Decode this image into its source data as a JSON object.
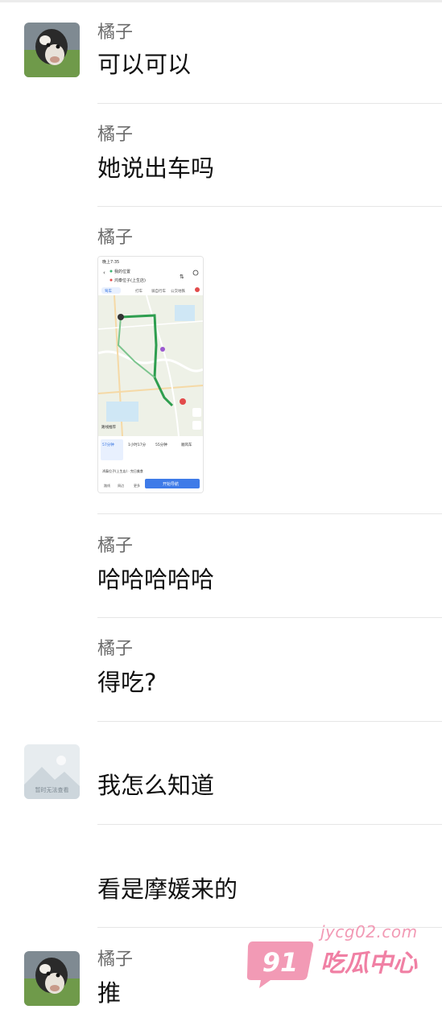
{
  "messages": [
    {
      "sender": "橘子",
      "text": "可以可以",
      "avatar": "cow-avatar"
    },
    {
      "sender": "橘子",
      "text": "她说出车吗"
    },
    {
      "sender": "橘子",
      "type": "image",
      "image": "map-navigation-screenshot"
    },
    {
      "sender": "橘子",
      "text": "哈哈哈哈哈"
    },
    {
      "sender": "橘子",
      "text": "得吃?"
    },
    {
      "sender": "",
      "text": "我怎么知道",
      "avatar": "placeholder-avatar"
    },
    {
      "sender": "",
      "text": "看是摩媛来的"
    },
    {
      "sender": "橘子",
      "text": "推",
      "avatar": "cow-avatar"
    }
  ],
  "avatar_placeholder_text": "暂时无法查看",
  "map": {
    "from": "我的位置",
    "to": "鸿泰位子(上生店)",
    "modes": [
      "驾车",
      "打车",
      "骑自行车",
      "公交地铁"
    ],
    "options": [
      {
        "time": "57分钟",
        "detail": "方案一"
      },
      {
        "time": "1小时17分",
        "detail": ""
      },
      {
        "time": "55分钟",
        "detail": ""
      },
      {
        "time": "顺风车",
        "detail": ""
      }
    ],
    "destination_bar": "鸿泰位子(上生店) · 完日美食",
    "start_button": "开始导航",
    "bottom_icons": [
      "路线",
      "周边搜索",
      "更多"
    ]
  },
  "watermark": {
    "badge": "91",
    "site": "jycg02.com",
    "title": "吃瓜中心",
    "color": "#f080a4"
  }
}
